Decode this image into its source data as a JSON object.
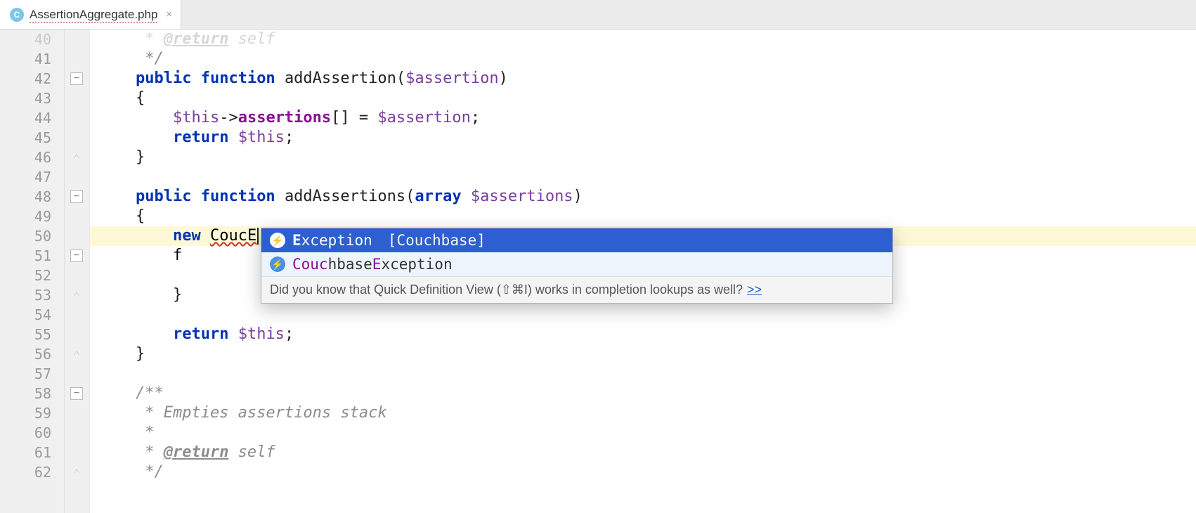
{
  "tab": {
    "icon_letter": "C",
    "label": "AssertionAggregate.php",
    "close_glyph": "×"
  },
  "editor": {
    "first_line": 40,
    "lines": [
      {
        "n": 40,
        "segs": [
          [
            "doc",
            "     * "
          ],
          [
            "doctag",
            "@return"
          ],
          [
            "doc",
            " self"
          ]
        ],
        "faded": true
      },
      {
        "n": 41,
        "segs": [
          [
            "doc",
            "     */"
          ]
        ]
      },
      {
        "n": 42,
        "segs": [
          [
            "plain",
            "    "
          ],
          [
            "kw",
            "public"
          ],
          [
            "plain",
            " "
          ],
          [
            "kw",
            "function"
          ],
          [
            "plain",
            " "
          ],
          [
            "fn",
            "addAssertion"
          ],
          [
            "punct",
            "("
          ],
          [
            "var",
            "$assertion"
          ],
          [
            "punct",
            ")"
          ]
        ]
      },
      {
        "n": 43,
        "segs": [
          [
            "plain",
            "    "
          ],
          [
            "punct",
            "{"
          ]
        ]
      },
      {
        "n": 44,
        "segs": [
          [
            "plain",
            "        "
          ],
          [
            "var",
            "$this"
          ],
          [
            "op",
            "->"
          ],
          [
            "prop",
            "assertions"
          ],
          [
            "punct",
            "[] = "
          ],
          [
            "var",
            "$assertion"
          ],
          [
            "punct",
            ";"
          ]
        ]
      },
      {
        "n": 45,
        "segs": [
          [
            "plain",
            "        "
          ],
          [
            "kw",
            "return"
          ],
          [
            "plain",
            " "
          ],
          [
            "var",
            "$this"
          ],
          [
            "punct",
            ";"
          ]
        ]
      },
      {
        "n": 46,
        "segs": [
          [
            "plain",
            "    "
          ],
          [
            "punct",
            "}"
          ]
        ]
      },
      {
        "n": 47,
        "segs": []
      },
      {
        "n": 48,
        "segs": [
          [
            "plain",
            "    "
          ],
          [
            "kw",
            "public"
          ],
          [
            "plain",
            " "
          ],
          [
            "kw",
            "function"
          ],
          [
            "plain",
            " "
          ],
          [
            "fn",
            "addAssertions"
          ],
          [
            "punct",
            "("
          ],
          [
            "kw",
            "array"
          ],
          [
            "plain",
            " "
          ],
          [
            "var",
            "$assertions"
          ],
          [
            "punct",
            ")"
          ]
        ]
      },
      {
        "n": 49,
        "segs": [
          [
            "plain",
            "    "
          ],
          [
            "punct",
            "{"
          ]
        ]
      },
      {
        "n": 50,
        "hl": true,
        "segs": [
          [
            "plain",
            "        "
          ],
          [
            "kw",
            "new"
          ],
          [
            "plain",
            " "
          ],
          [
            "err",
            "CoucE"
          ],
          [
            "caret",
            ""
          ]
        ]
      },
      {
        "n": 51,
        "segs": [
          [
            "plain",
            "        f"
          ]
        ]
      },
      {
        "n": 52,
        "segs": []
      },
      {
        "n": 53,
        "segs": [
          [
            "plain",
            "        "
          ],
          [
            "punct",
            "}"
          ]
        ]
      },
      {
        "n": 54,
        "segs": []
      },
      {
        "n": 55,
        "segs": [
          [
            "plain",
            "        "
          ],
          [
            "kw",
            "return"
          ],
          [
            "plain",
            " "
          ],
          [
            "var",
            "$this"
          ],
          [
            "punct",
            ";"
          ]
        ]
      },
      {
        "n": 56,
        "segs": [
          [
            "plain",
            "    "
          ],
          [
            "punct",
            "}"
          ]
        ]
      },
      {
        "n": 57,
        "segs": []
      },
      {
        "n": 58,
        "segs": [
          [
            "doc",
            "    /**"
          ]
        ]
      },
      {
        "n": 59,
        "segs": [
          [
            "doc",
            "     * Empties assertions stack"
          ]
        ]
      },
      {
        "n": 60,
        "segs": [
          [
            "doc",
            "     *"
          ]
        ]
      },
      {
        "n": 61,
        "segs": [
          [
            "doc",
            "     * "
          ],
          [
            "doctag",
            "@return"
          ],
          [
            "doc",
            " self"
          ]
        ]
      },
      {
        "n": 62,
        "segs": [
          [
            "doc",
            "     */"
          ]
        ]
      }
    ],
    "fold_markers": [
      {
        "line": 42,
        "type": "minus"
      },
      {
        "line": 46,
        "type": "end"
      },
      {
        "line": 48,
        "type": "minus"
      },
      {
        "line": 51,
        "type": "minus"
      },
      {
        "line": 53,
        "type": "end"
      },
      {
        "line": 56,
        "type": "end"
      },
      {
        "line": 58,
        "type": "minus"
      },
      {
        "line": 62,
        "type": "end"
      }
    ]
  },
  "completion": {
    "items": [
      {
        "icon": "⚡",
        "name_pre": "E",
        "name_match": "xception",
        "context": "[Couchbase]",
        "selected": true,
        "display_prefix": ""
      },
      {
        "icon": "⚡",
        "name_pre": "",
        "name_match": "Couc",
        "name_mid": "hbase",
        "name_suffix_match": "E",
        "name_suffix": "xception",
        "context": "",
        "selected": false
      }
    ],
    "hint_text": "Did you know that Quick Definition View (⇧⌘I) works in completion lookups as well?",
    "hint_link": ">>"
  }
}
